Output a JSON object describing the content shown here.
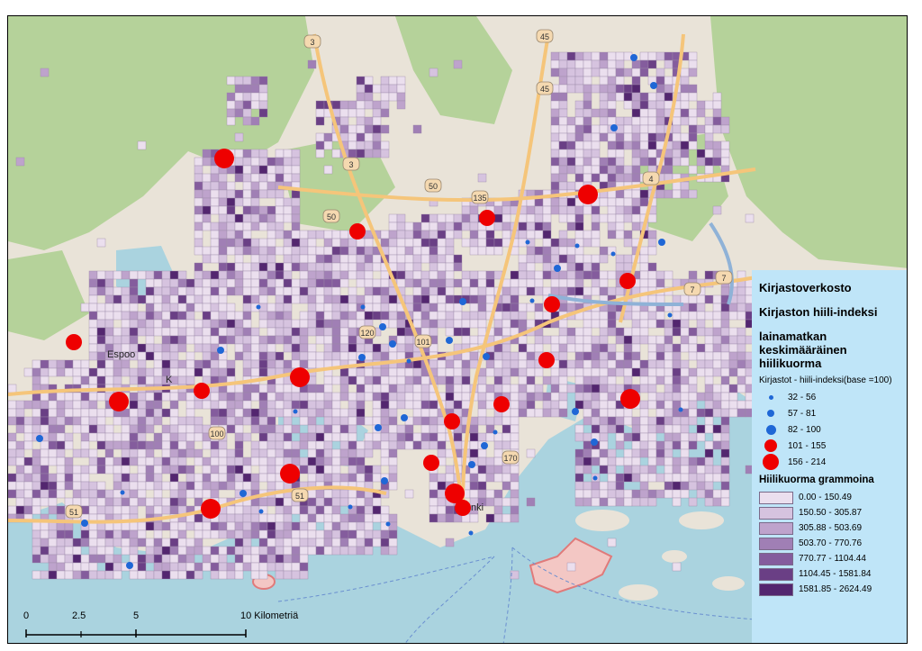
{
  "legend": {
    "title1": "Kirjastoverkosto",
    "title2": "Kirjaston hiili-indeksi",
    "title3": "lainamatkan keskimääräinen hiilikuorma",
    "libraries_label": "Kirjastot - hiili-indeksi(base =100)",
    "library_classes": [
      {
        "label": "32 - 56",
        "color": "#1f67d6",
        "size": 5
      },
      {
        "label": "57 - 81",
        "color": "#1f67d6",
        "size": 8
      },
      {
        "label": "82 - 100",
        "color": "#1f67d6",
        "size": 11
      },
      {
        "label": "101 - 155",
        "color": "#ee0000",
        "size": 14
      },
      {
        "label": "156 - 214",
        "color": "#ee0000",
        "size": 18
      }
    ],
    "carbon_title": "Hiilikuorma grammoina",
    "carbon_classes": [
      {
        "label": "0.00 - 150.49",
        "color": "#ebdfee"
      },
      {
        "label": "150.50 - 305.87",
        "color": "#d6c3df"
      },
      {
        "label": "305.88 - 503.69",
        "color": "#bea3cc"
      },
      {
        "label": "503.70 - 770.76",
        "color": "#a07fb5"
      },
      {
        "label": "770.77 - 1104.44",
        "color": "#845c9d"
      },
      {
        "label": "1104.45 - 1581.84",
        "color": "#6a3f85"
      },
      {
        "label": "1581.85 - 2624.49",
        "color": "#53266f"
      }
    ]
  },
  "scalebar": {
    "ticks": [
      "0",
      "2.5",
      "5",
      "10 Kilometriä"
    ]
  },
  "places": {
    "espoo": "Espoo",
    "helsinki": "nki",
    "k": "K"
  },
  "road_labels": [
    "3",
    "45",
    "45",
    "3",
    "50",
    "135",
    "50",
    "4",
    "7",
    "7",
    "101",
    "120",
    "170",
    "51",
    "51",
    "100"
  ]
}
